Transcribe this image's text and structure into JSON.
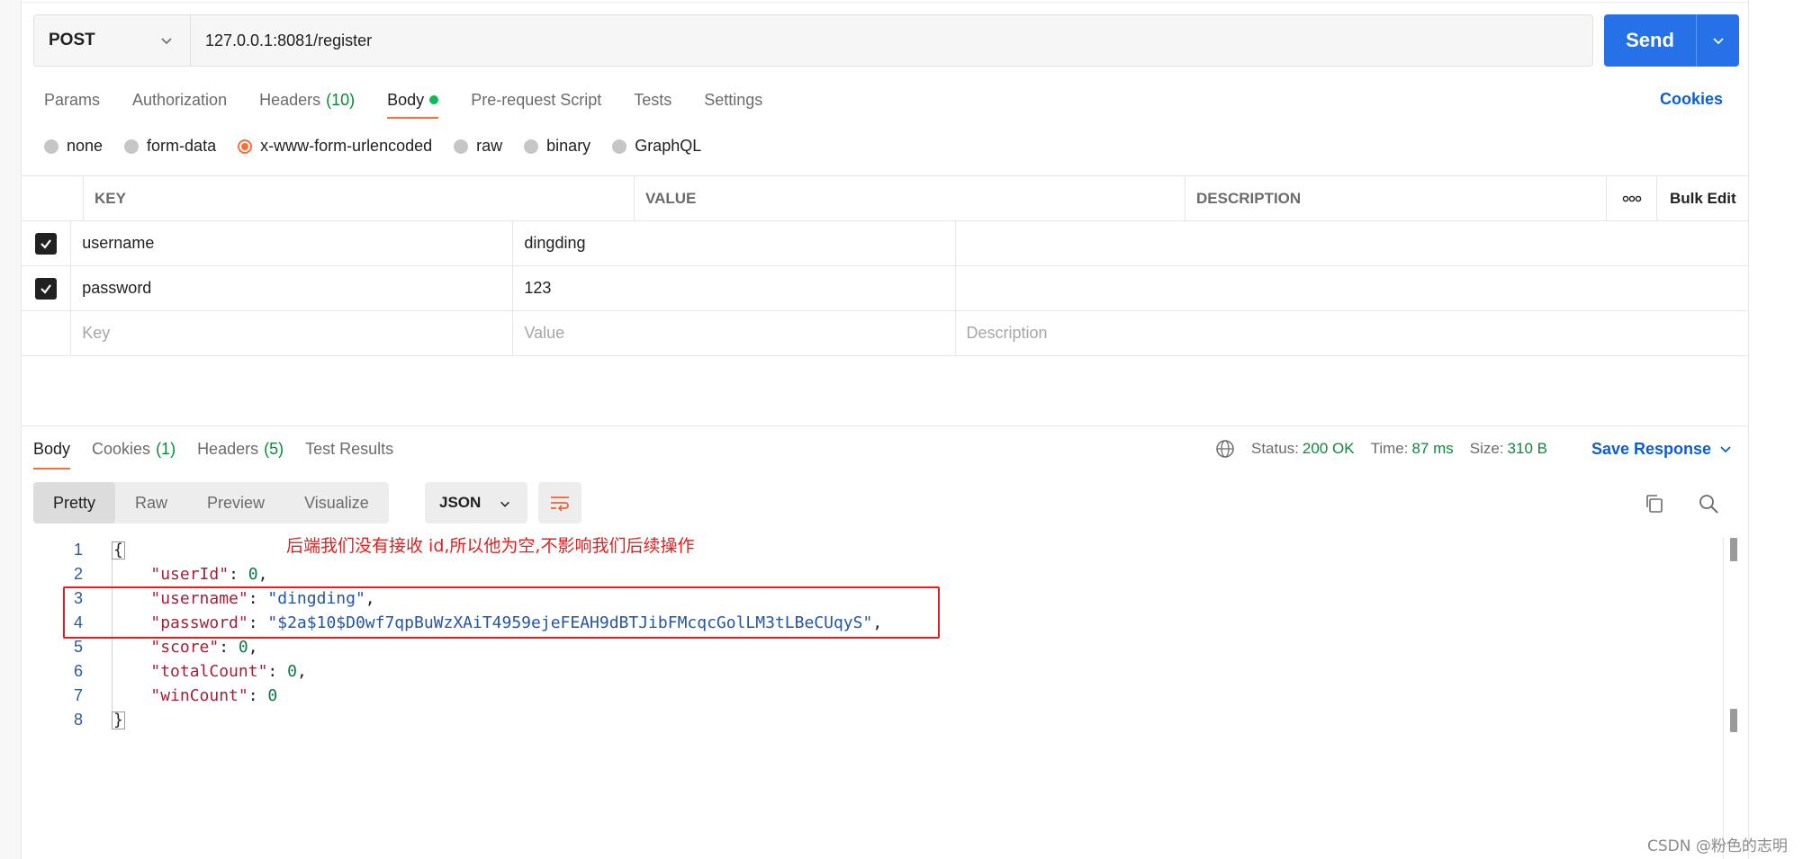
{
  "request": {
    "method": "POST",
    "url": "127.0.0.1:8081/register",
    "send_label": "Send"
  },
  "request_tabs": [
    {
      "label": "Params"
    },
    {
      "label": "Authorization"
    },
    {
      "label": "Headers",
      "count": "(10)"
    },
    {
      "label": "Body",
      "active": true
    },
    {
      "label": "Pre-request Script"
    },
    {
      "label": "Tests"
    },
    {
      "label": "Settings"
    }
  ],
  "cookies_label": "Cookies",
  "body_types": [
    "none",
    "form-data",
    "x-www-form-urlencoded",
    "raw",
    "binary",
    "GraphQL"
  ],
  "body_type_selected": "x-www-form-urlencoded",
  "params_table": {
    "headers": [
      "KEY",
      "VALUE",
      "DESCRIPTION"
    ],
    "bulk_edit_label": "Bulk Edit",
    "rows": [
      {
        "key": "username",
        "value": "dingding",
        "description": "",
        "checked": true
      },
      {
        "key": "password",
        "value": "123",
        "description": "",
        "checked": true
      }
    ],
    "placeholders": {
      "key": "Key",
      "value": "Value",
      "description": "Description"
    }
  },
  "response_tabs": [
    {
      "label": "Body",
      "active": true
    },
    {
      "label": "Cookies",
      "count": "(1)"
    },
    {
      "label": "Headers",
      "count": "(5)"
    },
    {
      "label": "Test Results"
    }
  ],
  "response_status": {
    "status_label": "Status:",
    "status_value": "200 OK",
    "time_label": "Time:",
    "time_value": "87 ms",
    "size_label": "Size:",
    "size_value": "310 B"
  },
  "save_response_label": "Save Response",
  "format_buttons": [
    "Pretty",
    "Raw",
    "Preview",
    "Visualize"
  ],
  "format_selected": "Pretty",
  "language": "JSON",
  "code_lines": [
    {
      "n": "1",
      "parts": [
        {
          "t": "{",
          "c": "brace"
        }
      ]
    },
    {
      "n": "2",
      "parts": [
        {
          "t": "    ",
          "c": "p"
        },
        {
          "t": "\"userId\"",
          "c": "k"
        },
        {
          "t": ": ",
          "c": "p"
        },
        {
          "t": "0",
          "c": "n"
        },
        {
          "t": ",",
          "c": "p"
        }
      ]
    },
    {
      "n": "3",
      "parts": [
        {
          "t": "    ",
          "c": "p"
        },
        {
          "t": "\"username\"",
          "c": "k"
        },
        {
          "t": ": ",
          "c": "p"
        },
        {
          "t": "\"dingding\"",
          "c": "s"
        },
        {
          "t": ",",
          "c": "p"
        }
      ]
    },
    {
      "n": "4",
      "parts": [
        {
          "t": "    ",
          "c": "p"
        },
        {
          "t": "\"password\"",
          "c": "k"
        },
        {
          "t": ": ",
          "c": "p"
        },
        {
          "t": "\"$2a$10$D0wf7qpBuWzXAiT4959ejeFEAH9dBTJibFMcqcGolLM3tLBeCUqyS\"",
          "c": "s"
        },
        {
          "t": ",",
          "c": "p"
        }
      ]
    },
    {
      "n": "5",
      "parts": [
        {
          "t": "    ",
          "c": "p"
        },
        {
          "t": "\"score\"",
          "c": "k"
        },
        {
          "t": ": ",
          "c": "p"
        },
        {
          "t": "0",
          "c": "n"
        },
        {
          "t": ",",
          "c": "p"
        }
      ]
    },
    {
      "n": "6",
      "parts": [
        {
          "t": "    ",
          "c": "p"
        },
        {
          "t": "\"totalCount\"",
          "c": "k"
        },
        {
          "t": ": ",
          "c": "p"
        },
        {
          "t": "0",
          "c": "n"
        },
        {
          "t": ",",
          "c": "p"
        }
      ]
    },
    {
      "n": "7",
      "parts": [
        {
          "t": "    ",
          "c": "p"
        },
        {
          "t": "\"winCount\"",
          "c": "k"
        },
        {
          "t": ": ",
          "c": "p"
        },
        {
          "t": "0",
          "c": "n"
        }
      ]
    },
    {
      "n": "8",
      "parts": [
        {
          "t": "}",
          "c": "brace"
        }
      ]
    }
  ],
  "annotation": "后端我们没有接收 id,所以他为空,不影响我们后续操作",
  "watermark": "CSDN @粉色的志明",
  "colors": {
    "accent": "#ff6c37",
    "send": "#2670e8",
    "link": "#0b5fcf",
    "success": "#0a8a3b",
    "annotation": "#e02020"
  }
}
